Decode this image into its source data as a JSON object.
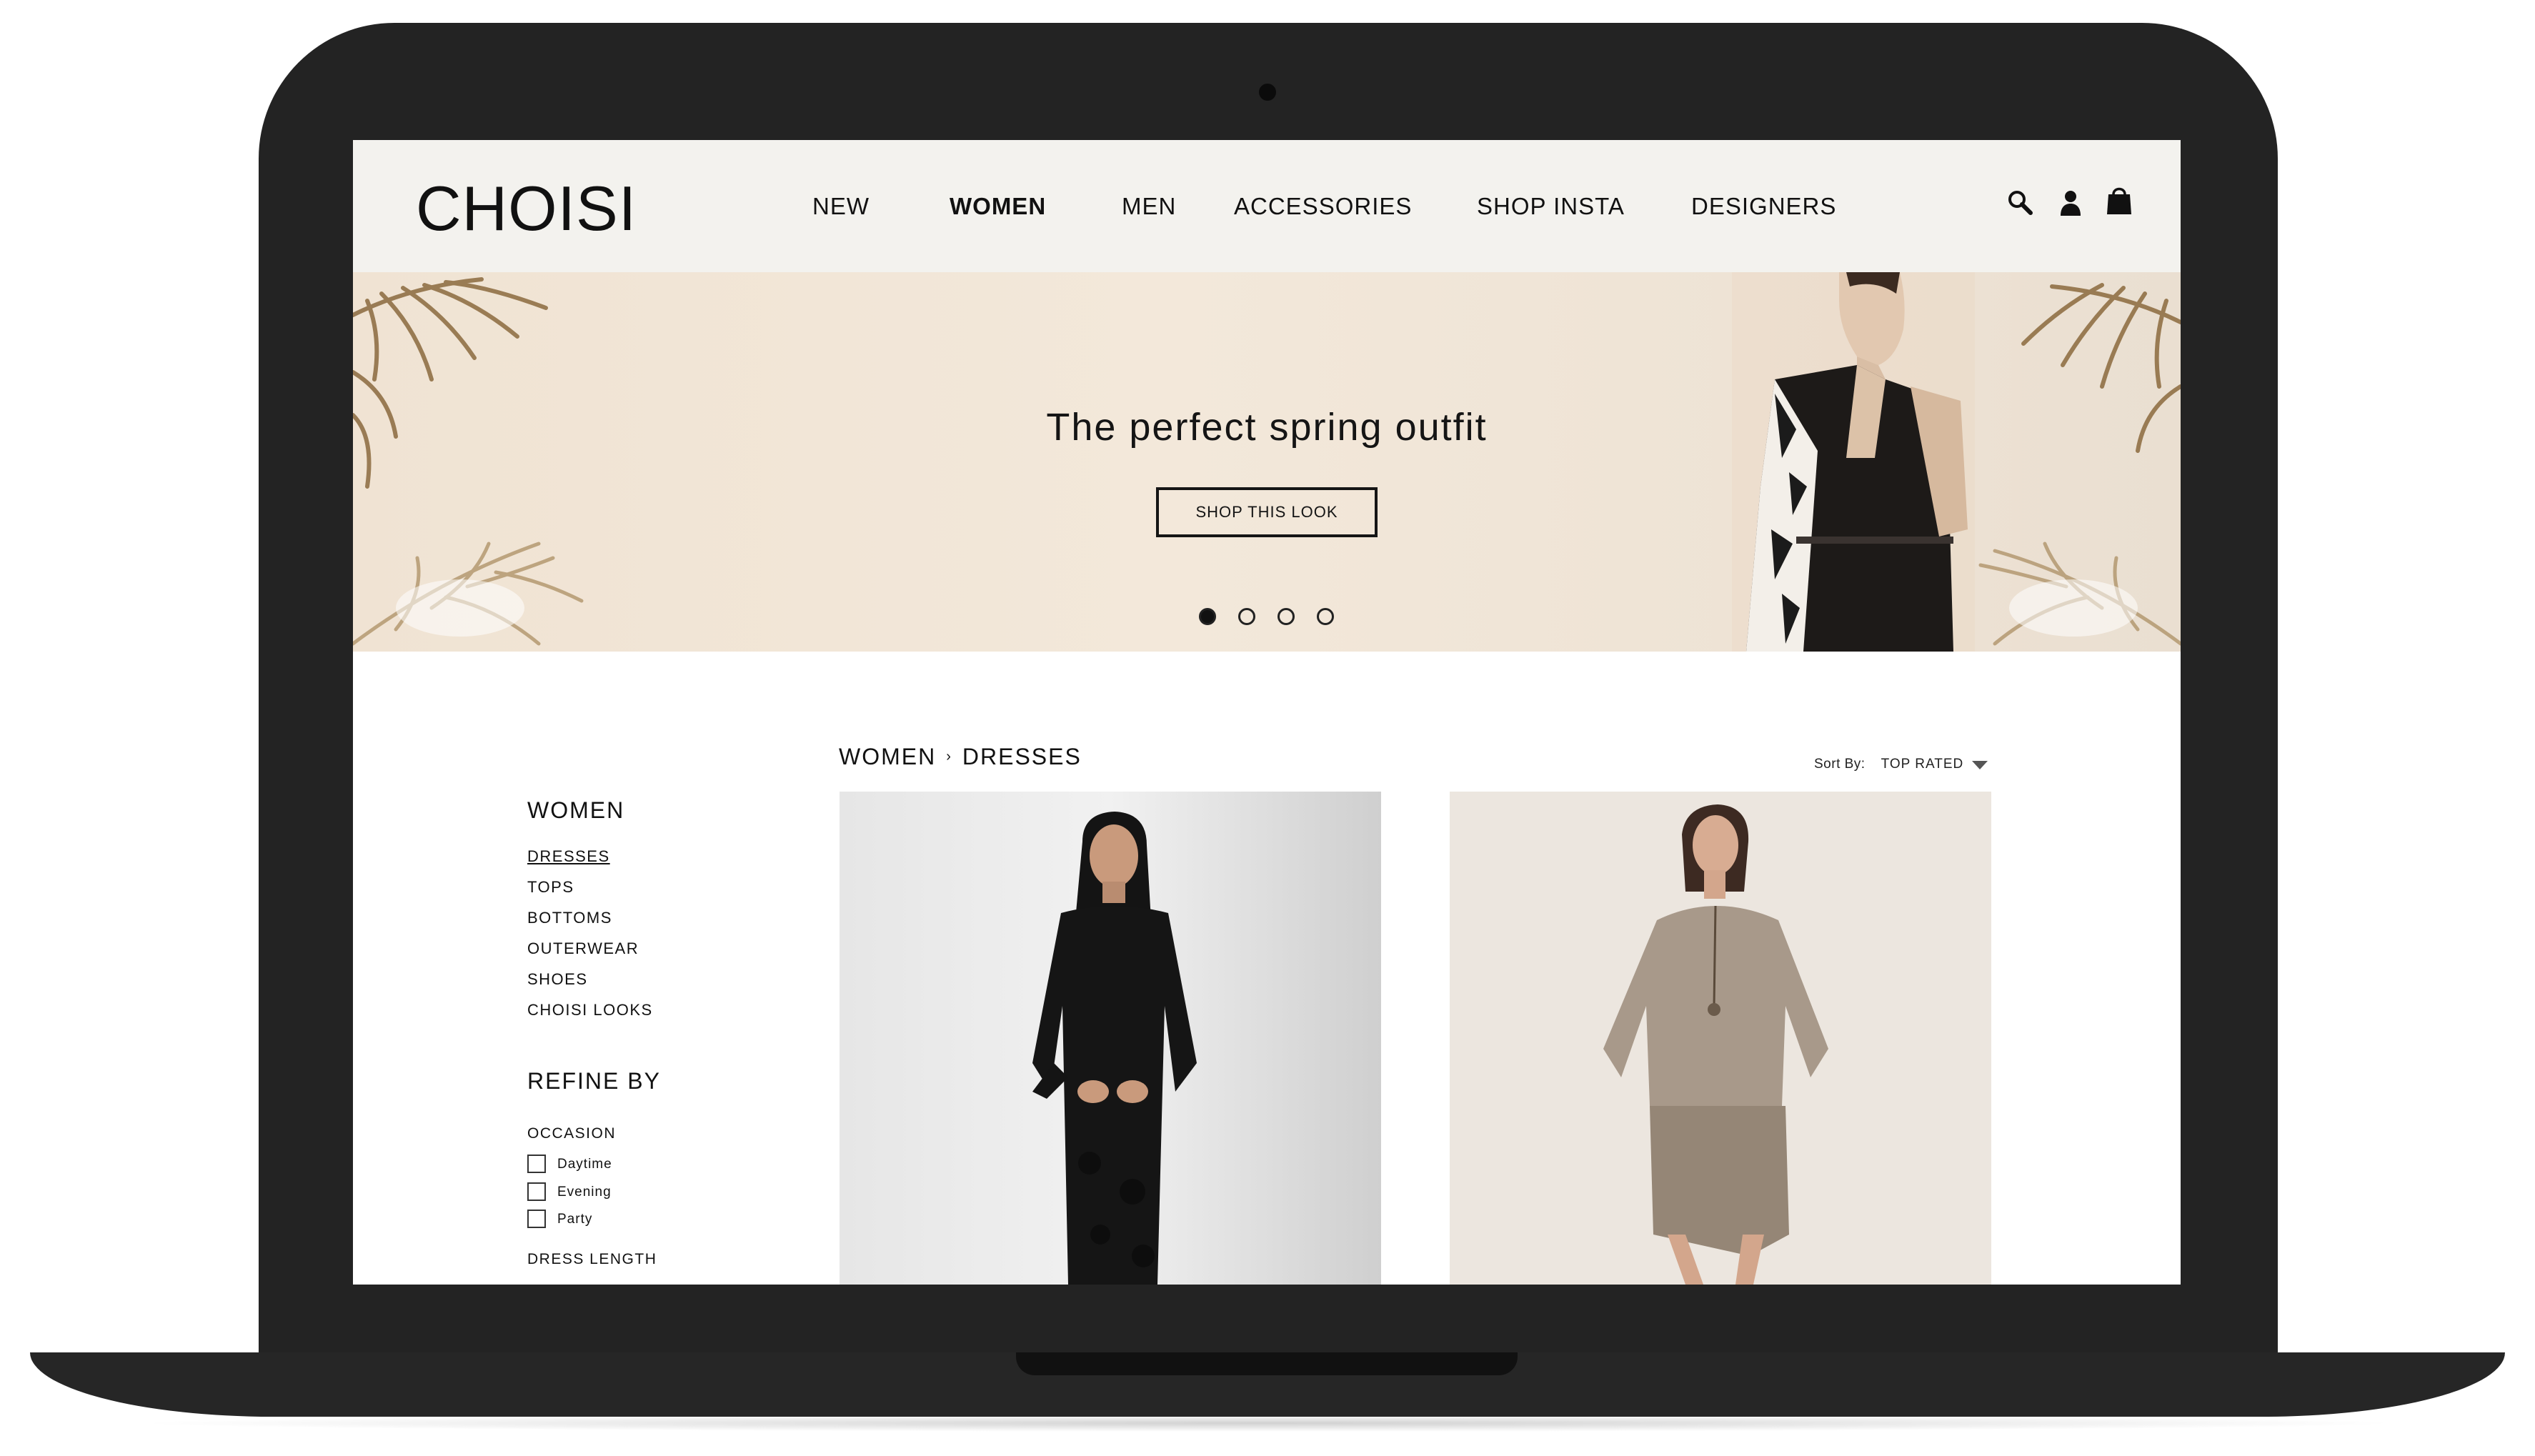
{
  "header": {
    "logo": "CHOISI",
    "nav": [
      {
        "label": "NEW"
      },
      {
        "label": "WOMEN"
      },
      {
        "label": "MEN"
      },
      {
        "label": "ACCESSORIES"
      },
      {
        "label": "SHOP INSTA"
      },
      {
        "label": "DESIGNERS"
      }
    ],
    "active_nav": "WOMEN",
    "icons": [
      "search-icon",
      "account-icon",
      "shopping-bag-icon"
    ]
  },
  "hero": {
    "headline": "The perfect spring outfit",
    "button_label": "SHOP THIS LOOK",
    "slide_count": 4,
    "active_slide": 1
  },
  "breadcrumb": {
    "parent": "WOMEN",
    "separator": "›",
    "current": "DRESSES"
  },
  "sort": {
    "label": "Sort By:",
    "selected": "TOP RATED"
  },
  "sidebar": {
    "heading": "WOMEN",
    "categories": [
      {
        "label": "DRESSES"
      },
      {
        "label": "TOPS"
      },
      {
        "label": "BOTTOMS"
      },
      {
        "label": "OUTERWEAR"
      },
      {
        "label": "SHOES"
      },
      {
        "label": "CHOISI LOOKS"
      }
    ],
    "active_category": "DRESSES",
    "refine_heading": "REFINE BY",
    "occasion_label": "OCCASION",
    "occasion_options": [
      {
        "label": "Daytime",
        "checked": false
      },
      {
        "label": "Evening",
        "checked": false
      },
      {
        "label": "Party",
        "checked": false
      }
    ],
    "dress_length_label": "DRESS LENGTH"
  },
  "products": [
    {
      "image": "black-long-sleeve-dress-photo"
    },
    {
      "image": "knit-sweater-dress-photo"
    }
  ],
  "colors": {
    "header_bg": "#f3f2ee",
    "hero_bg": "#f3e8da",
    "frame": "#232323",
    "text": "#111111"
  }
}
